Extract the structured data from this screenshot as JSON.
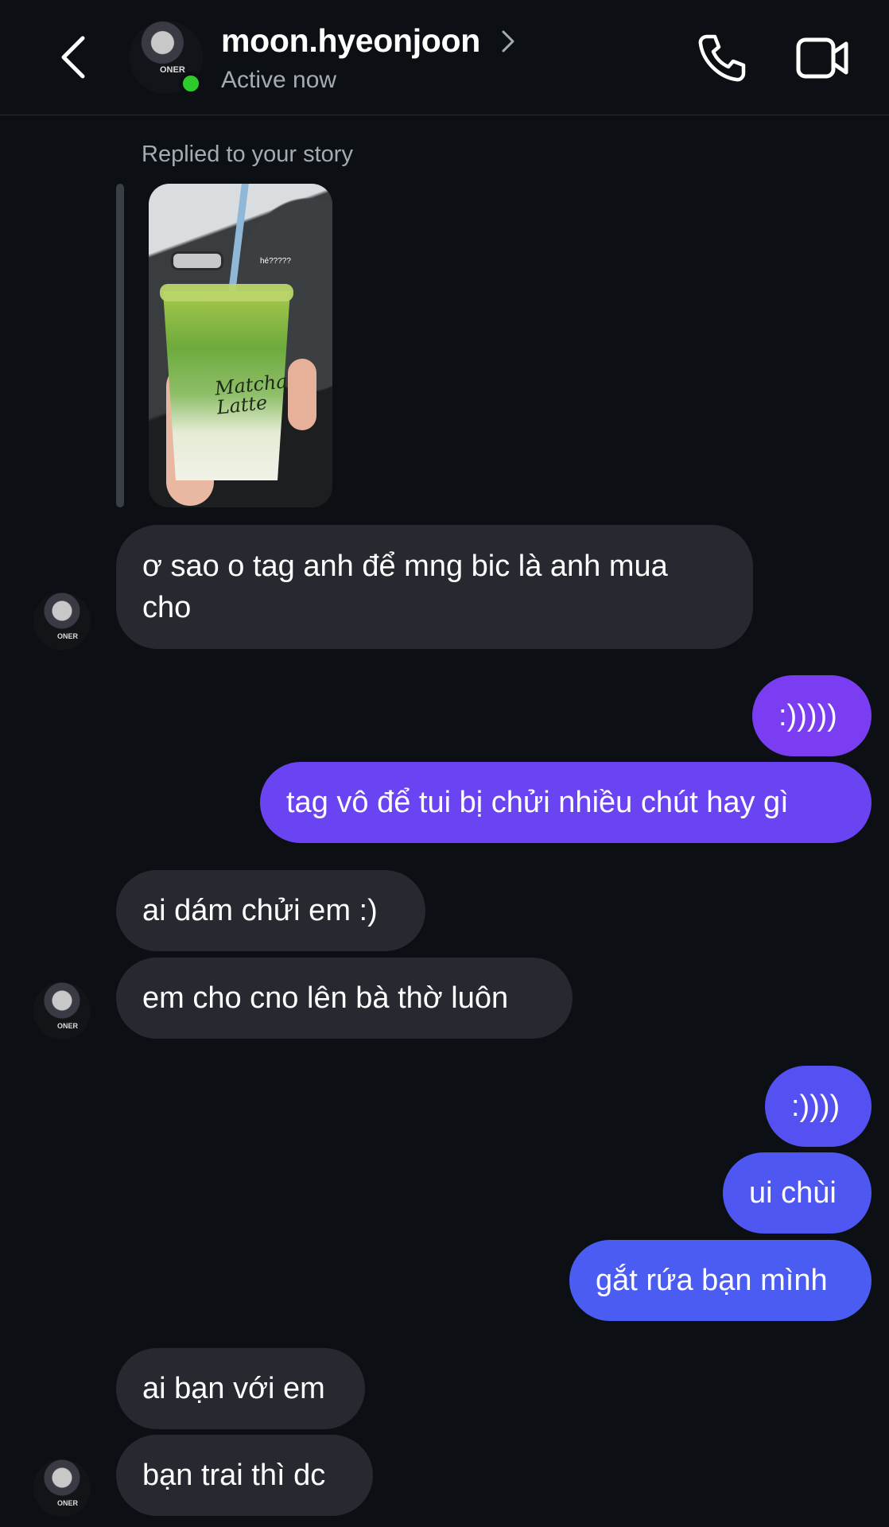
{
  "header": {
    "username": "moon.hyeonjoon",
    "status": "Active now",
    "avatar_text": "ONER"
  },
  "icons": {
    "back": "chevron-left-icon",
    "profile_chevron": "chevron-right-icon",
    "call": "phone-icon",
    "video": "video-camera-icon"
  },
  "story": {
    "label": "Replied to your story",
    "caption": "hé?????",
    "cup_text": "Matcha Latte"
  },
  "messages": [
    {
      "from": "them",
      "text": "ơ sao o tag anh để mng bic là anh mua cho"
    },
    {
      "from": "me",
      "text": ":)))))"
    },
    {
      "from": "me",
      "text": "tag vô để tui bị chửi nhiều chút hay gì"
    },
    {
      "from": "them",
      "text": "ai dám chửi em :)"
    },
    {
      "from": "them",
      "text": "em cho cno lên bà thờ luôn"
    },
    {
      "from": "me",
      "text": ":))))"
    },
    {
      "from": "me",
      "text": "ui chùi"
    },
    {
      "from": "me",
      "text": "gắt rứa bạn mình"
    },
    {
      "from": "them",
      "text": "ai bạn với em"
    },
    {
      "from": "them",
      "text": "bạn trai thì dc"
    }
  ],
  "colors": {
    "background": "#0c1014",
    "incoming_bubble": "#262a30",
    "outgoing_purple": "#7a3df1",
    "outgoing_violet": "#6548f2",
    "outgoing_blue": "#4a5cf2",
    "online": "#2ecc2a"
  }
}
